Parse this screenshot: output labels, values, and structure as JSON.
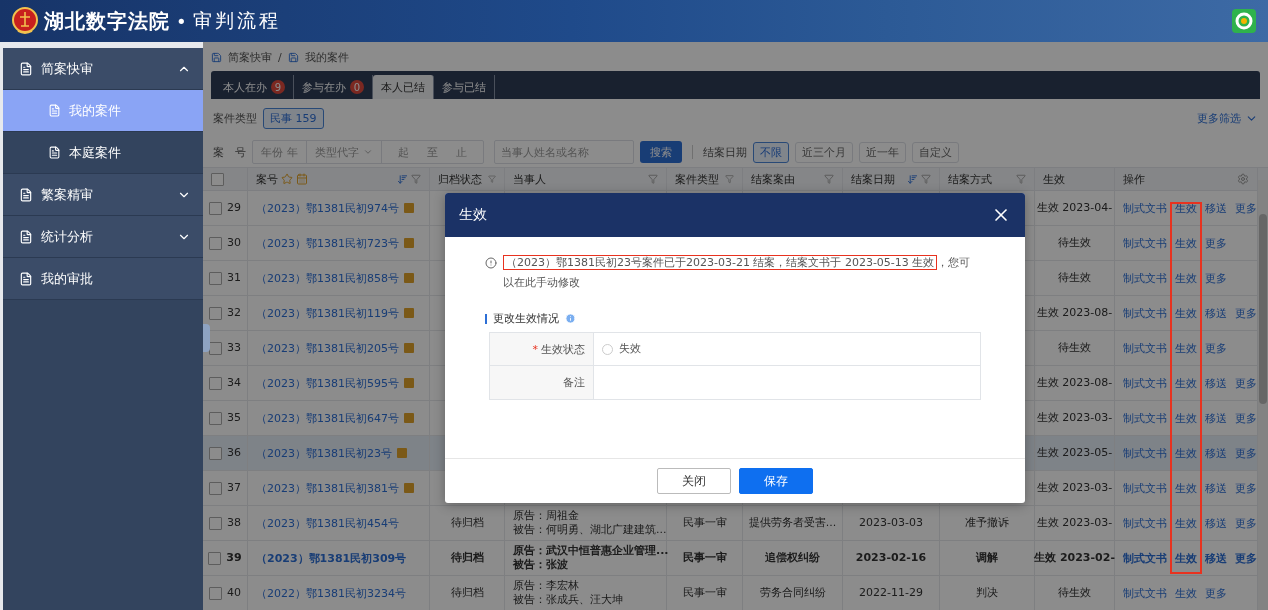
{
  "header": {
    "title": "湖北数字法院",
    "separator": "•",
    "subtitle": "审判流程"
  },
  "sidebar": {
    "items": [
      {
        "label": "简案快审",
        "kind": "group",
        "expanded": true,
        "selected": false,
        "children": [
          {
            "label": "我的案件",
            "selected": true
          },
          {
            "label": "本庭案件",
            "selected": false
          }
        ]
      },
      {
        "label": "繁案精审",
        "kind": "group",
        "expanded": false,
        "selected": false
      },
      {
        "label": "统计分析",
        "kind": "group",
        "expanded": false,
        "selected": false
      },
      {
        "label": "我的审批",
        "kind": "link",
        "selected": false
      }
    ]
  },
  "breadcrumb": [
    "简案快审",
    "我的案件"
  ],
  "breadcrumb_separator": "/",
  "tabs": [
    {
      "label": "本人在办",
      "count": "9",
      "selected": false
    },
    {
      "label": "参与在办",
      "count": "0",
      "selected": false
    },
    {
      "label": "本人已结",
      "selected": true
    },
    {
      "label": "参与已结",
      "selected": false
    }
  ],
  "filters": {
    "case_type_label": "案件类型",
    "case_type_chips": [
      {
        "label": "民事 159",
        "selected": true
      }
    ],
    "more": "更多筛选",
    "case_no_label": "案　号",
    "year_placeholder": "年份",
    "year_suffix": "年",
    "type_placeholder": "类型代字",
    "from_placeholder": "起",
    "range_sep": "至",
    "to_placeholder": "止",
    "party_placeholder": "当事人姓名或名称",
    "search": "搜索",
    "date_label": "结案日期",
    "date_chips": [
      {
        "label": "不限",
        "selected": true
      },
      {
        "label": "近三个月",
        "selected": false
      },
      {
        "label": "近一年",
        "selected": false
      },
      {
        "label": "自定义",
        "selected": false
      }
    ]
  },
  "table": {
    "select_all": {
      "checked": false
    },
    "columns": [
      {
        "label": "案号"
      },
      {
        "label": "归档状态"
      },
      {
        "label": "当事人"
      },
      {
        "label": "案件类型"
      },
      {
        "label": "结案案由"
      },
      {
        "label": "结案日期"
      },
      {
        "label": "结案方式"
      },
      {
        "label": "生效"
      },
      {
        "label": "操作"
      }
    ],
    "rows": [
      {
        "num": "29",
        "checked": false,
        "selected": false,
        "bold": false,
        "case_no": "（2023）鄂1381民初974号",
        "badge": true,
        "effect": "生效 2023-04-",
        "actions": [
          "制式文书",
          "生效",
          "移送",
          "更多"
        ]
      },
      {
        "num": "30",
        "checked": false,
        "selected": false,
        "bold": false,
        "case_no": "（2023）鄂1381民初723号",
        "badge": true,
        "effect": "待生效",
        "actions": [
          "制式文书",
          "生效",
          "更多"
        ]
      },
      {
        "num": "31",
        "checked": false,
        "selected": false,
        "bold": false,
        "case_no": "（2023）鄂1381民初858号",
        "badge": true,
        "effect": "待生效",
        "actions": [
          "制式文书",
          "生效",
          "更多"
        ]
      },
      {
        "num": "32",
        "checked": false,
        "selected": false,
        "bold": false,
        "case_no": "（2023）鄂1381民初119号",
        "badge": true,
        "effect": "生效 2023-08-",
        "actions": [
          "制式文书",
          "生效",
          "移送",
          "更多"
        ]
      },
      {
        "num": "33",
        "checked": false,
        "selected": false,
        "bold": false,
        "case_no": "（2023）鄂1381民初205号",
        "badge": true,
        "effect": "待生效",
        "actions": [
          "制式文书",
          "生效",
          "更多"
        ]
      },
      {
        "num": "34",
        "checked": false,
        "selected": false,
        "bold": false,
        "case_no": "（2023）鄂1381民初595号",
        "badge": true,
        "effect": "生效 2023-08-",
        "actions": [
          "制式文书",
          "生效",
          "移送",
          "更多"
        ]
      },
      {
        "num": "35",
        "checked": false,
        "selected": false,
        "bold": false,
        "case_no": "（2023）鄂1381民初647号",
        "badge": true,
        "effect": "生效 2023-03-",
        "actions": [
          "制式文书",
          "生效",
          "移送",
          "更多"
        ]
      },
      {
        "num": "36",
        "checked": false,
        "selected": true,
        "bold": false,
        "case_no": "（2023）鄂1381民初23号",
        "badge": true,
        "effect": "生效 2023-05-",
        "actions": [
          "制式文书",
          "生效",
          "移送",
          "更多"
        ]
      },
      {
        "num": "37",
        "checked": false,
        "selected": false,
        "bold": false,
        "case_no": "（2023）鄂1381民初381号",
        "badge": true,
        "effect": "生效 2023-03-",
        "actions": [
          "制式文书",
          "生效",
          "移送",
          "更多"
        ]
      },
      {
        "num": "38",
        "checked": false,
        "selected": false,
        "bold": false,
        "case_no": "（2023）鄂1381民初454号",
        "badge": false,
        "archive": "待归档",
        "parties": [
          "原告：周祖金",
          "被告：何明勇、湖北广建建筑..."
        ],
        "case_type": "民事一审",
        "cause": "提供劳务者受害...",
        "date": "2023-03-03",
        "method": "准予撤诉",
        "effect": "生效 2023-03-",
        "actions": [
          "制式文书",
          "生效",
          "移送",
          "更多"
        ]
      },
      {
        "num": "39",
        "checked": false,
        "selected": false,
        "bold": true,
        "case_no": "（2023）鄂1381民初309号",
        "badge": false,
        "archive": "待归档",
        "parties": [
          "原告：武汉中恒普惠企业管理...",
          "被告：张波"
        ],
        "case_type": "民事一审",
        "cause": "追偿权纠纷",
        "date": "2023-02-16",
        "method": "调解",
        "effect": "生效 2023-02-",
        "actions": [
          "制式文书",
          "生效",
          "移送",
          "更多"
        ]
      },
      {
        "num": "40",
        "checked": false,
        "selected": false,
        "bold": false,
        "case_no": "（2022）鄂1381民初3234号",
        "badge": false,
        "archive": "待归档",
        "parties": [
          "原告：李宏林",
          "被告：张成兵、汪大坤"
        ],
        "case_type": "民事一审",
        "cause": "劳务合同纠纷",
        "date": "2022-11-29",
        "method": "判决",
        "effect": "待生效",
        "actions": [
          "制式文书",
          "生效",
          "更多"
        ]
      }
    ]
  },
  "modal": {
    "title": "生效",
    "notice": {
      "highlight": "（2023）鄂1381民初23号案件已于2023-03-21 结案，结案文书于 2023-05-13 生效",
      "rest": "，您可以在此手动修改"
    },
    "section": "更改生效情况",
    "fields": [
      {
        "label": "生效状态",
        "required_mark": "*",
        "kind": "radio",
        "options": [
          {
            "label": "失效",
            "selected": false
          }
        ]
      },
      {
        "label": "备注",
        "kind": "text"
      }
    ],
    "buttons": [
      {
        "label": "关闭",
        "kind": "secondary"
      },
      {
        "label": "保存",
        "kind": "primary"
      }
    ]
  }
}
